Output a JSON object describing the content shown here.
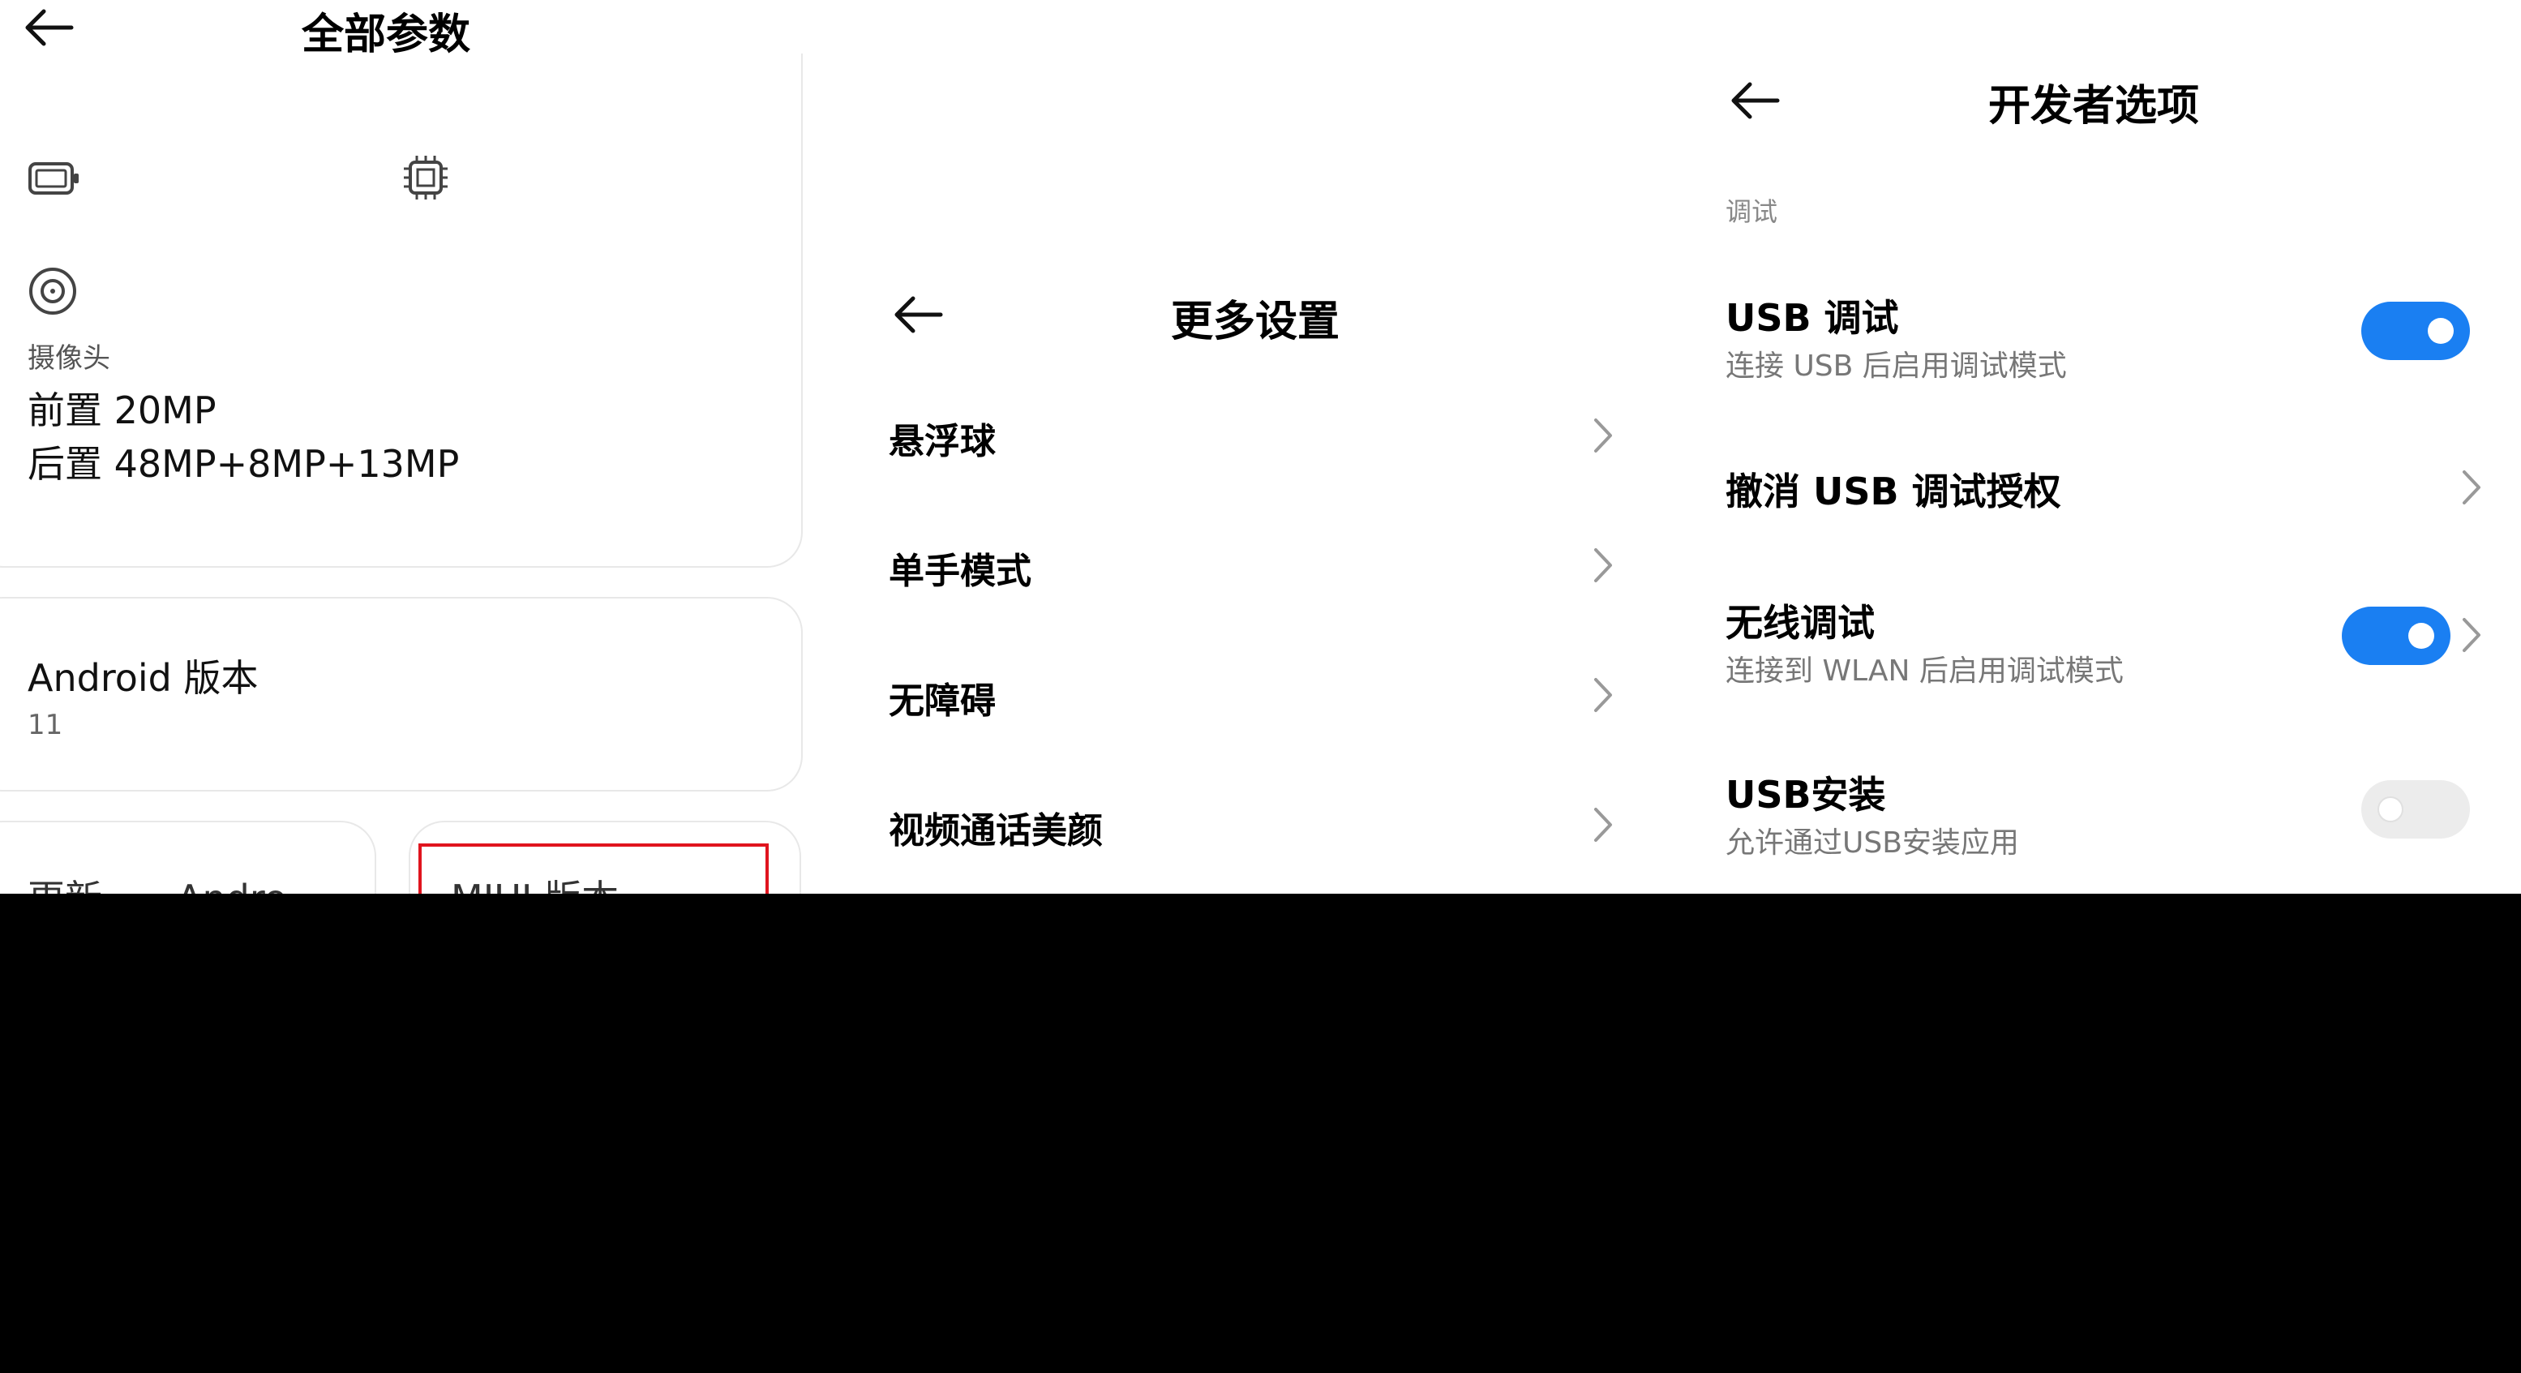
{
  "panel_specs": {
    "title": "全部参数",
    "camera": {
      "label": "摄像头",
      "front": "前置 20MP",
      "rear": "后置 48MP+8MP+13MP"
    },
    "android": {
      "label": "Android 版本",
      "value": "11"
    },
    "bottom_cards": {
      "left_text": "更新　　Andro",
      "right_text": "MIUI 版本"
    },
    "icons": [
      "battery-icon",
      "chip-icon",
      "camera-lens-icon",
      "back-arrow-icon"
    ]
  },
  "panel_more": {
    "title": "更多设置",
    "items": [
      {
        "label": "悬浮球"
      },
      {
        "label": "单手模式"
      },
      {
        "label": "无障碍"
      },
      {
        "label": "视频通话美颜"
      }
    ]
  },
  "panel_dev": {
    "title": "开发者选项",
    "section": "调试",
    "rows": [
      {
        "title": "USB 调试",
        "subtitle": "连接 USB 后启用调试模式",
        "toggle": "on"
      },
      {
        "title": "撤消 USB 调试授权",
        "subtitle": "",
        "toggle": "none"
      },
      {
        "title": "无线调试",
        "subtitle": "连接到 WLAN 后启用调试模式",
        "toggle": "on"
      },
      {
        "title": "USB安装",
        "subtitle": "允许通过USB安装应用",
        "toggle": "off"
      }
    ]
  },
  "colors": {
    "toggle_on": "#1a7ff2",
    "toggle_off": "#ececec",
    "highlight_box": "#e0141e",
    "background_bottom": "#000000"
  }
}
